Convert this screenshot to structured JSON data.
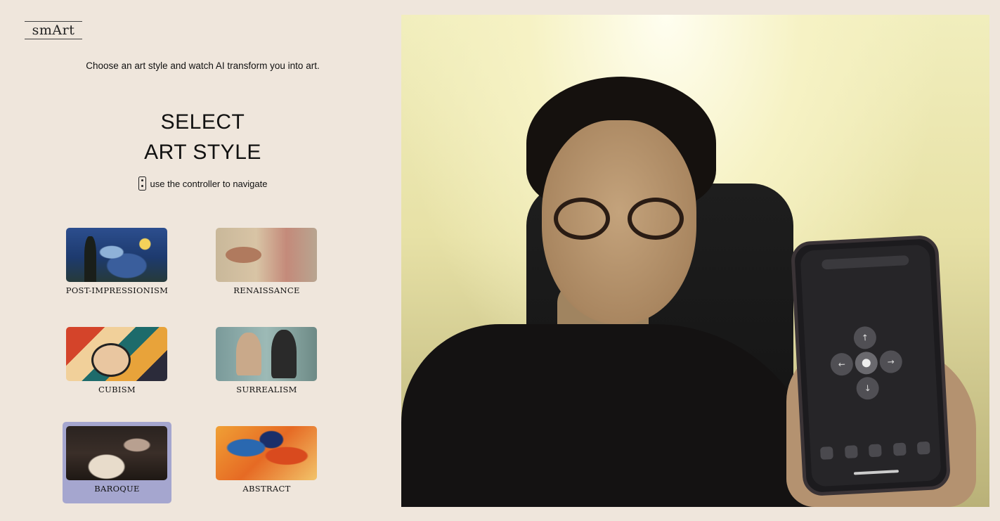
{
  "app": {
    "logo": "smArt",
    "tagline": "Choose an art style and watch AI transform you into art.",
    "heading_line1": "SELECT",
    "heading_line2": "ART STYLE",
    "hint": "use the controller to navigate"
  },
  "styles": [
    {
      "label": "POST-IMPRESSIONISM",
      "selected": false
    },
    {
      "label": "RENAISSANCE",
      "selected": false
    },
    {
      "label": "CUBISM",
      "selected": false
    },
    {
      "label": "SURREALISM",
      "selected": false
    },
    {
      "label": "BAROQUE",
      "selected": true
    },
    {
      "label": "ABSTRACT",
      "selected": false
    }
  ],
  "colors": {
    "background": "#efe6dc",
    "selected": "#a5a6cf"
  },
  "icons": [
    "remote-controller-icon",
    "arrow-up-icon",
    "arrow-left-icon",
    "arrow-right-icon",
    "arrow-down-icon"
  ],
  "phone": {
    "dpad_up": "↑",
    "dpad_left": "←",
    "dpad_right": "→",
    "dpad_down": "↓"
  }
}
